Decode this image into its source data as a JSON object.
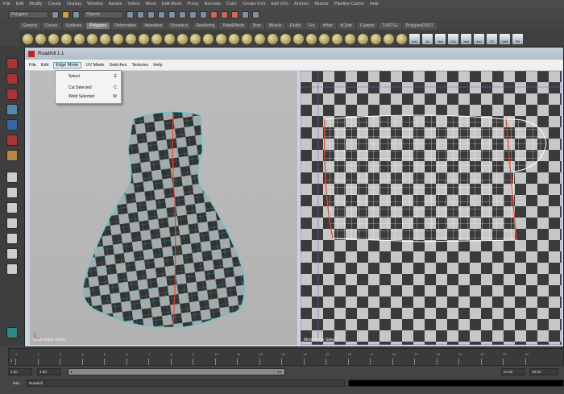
{
  "menubar": [
    "File",
    "Edit",
    "Modify",
    "Create",
    "Display",
    "Window",
    "Assets",
    "Select",
    "Mesh",
    "Edit Mesh",
    "Proxy",
    "Normals",
    "Color",
    "Create UVs",
    "Edit UVs",
    "Arsnvin",
    "Muscle",
    "Pipeline Cache",
    "Help"
  ],
  "toolbar": {
    "mode": "Polygons",
    "objects": "Objects"
  },
  "shelf_tabs": [
    "General",
    "Curves",
    "Surfaces",
    "Polygons",
    "Deformation",
    "Animation",
    "Dynamics",
    "Rendering",
    "PaintEffects",
    "Toon",
    "Muscle",
    "Fluids",
    "Fur",
    "nHair",
    "nCloth",
    "Custom",
    "TURTLE",
    "Polygons02572"
  ],
  "shelf_active": "Polygons",
  "shelf_labels": [
    "Uvs1",
    "All",
    "Mad",
    "UV1",
    "Indvl",
    "Uvs1",
    "CP",
    "TgtSh",
    "PB"
  ],
  "roadkill": {
    "title": "RoadKill 1.1",
    "menu": [
      "File",
      "Edit",
      "Edge Mode",
      "UV Mode",
      "Switches",
      "Textures",
      "Help"
    ],
    "open_menu": "Edge Mode",
    "dropdown": [
      {
        "label": "Select",
        "key": "E"
      },
      {
        "label": "Cut Selected",
        "key": "C"
      },
      {
        "label": "Weld Selected",
        "key": "W"
      }
    ],
    "left_status": "Mode  Edge  Select",
    "right_status": "Mode  Edge  Select"
  },
  "timeline": {
    "ticks": [
      "1",
      "2",
      "3",
      "4",
      "5",
      "6",
      "7",
      "8",
      "9",
      "10",
      "11",
      "12",
      "13",
      "14",
      "15",
      "16",
      "17",
      "18",
      "19",
      "20",
      "21",
      "22",
      "23",
      "24"
    ],
    "current": "1"
  },
  "range": {
    "start": "1.00",
    "start2": "1.00",
    "slider_start": "1",
    "slider_end": "24",
    "end": "24.00",
    "end2": "48.00"
  },
  "mel": {
    "label": "MEL",
    "value": "RoadKill"
  },
  "colors": {
    "cut_edge": "#e8402a",
    "wire": "#3fd0d8"
  }
}
